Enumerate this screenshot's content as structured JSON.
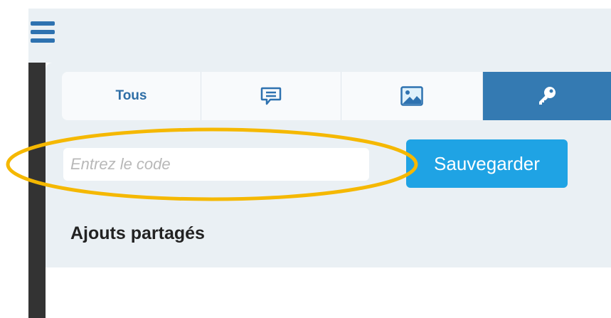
{
  "header": {
    "menu_icon": "hamburger-menu-icon"
  },
  "tabs": [
    {
      "label": "Tous",
      "icon": null
    },
    {
      "label": "",
      "icon": "chat-bubble-icon"
    },
    {
      "label": "",
      "icon": "image-icon"
    },
    {
      "label": "",
      "icon": "key-icon",
      "active": true
    }
  ],
  "code_form": {
    "placeholder": "Entrez le code",
    "value": "",
    "save_label": "Sauvegarder"
  },
  "section": {
    "title": "Ajouts partagés"
  },
  "colors": {
    "accent": "#347ab2",
    "button": "#1fa3e4",
    "highlight": "#f5b800",
    "panel_bg": "#eaf0f4"
  }
}
